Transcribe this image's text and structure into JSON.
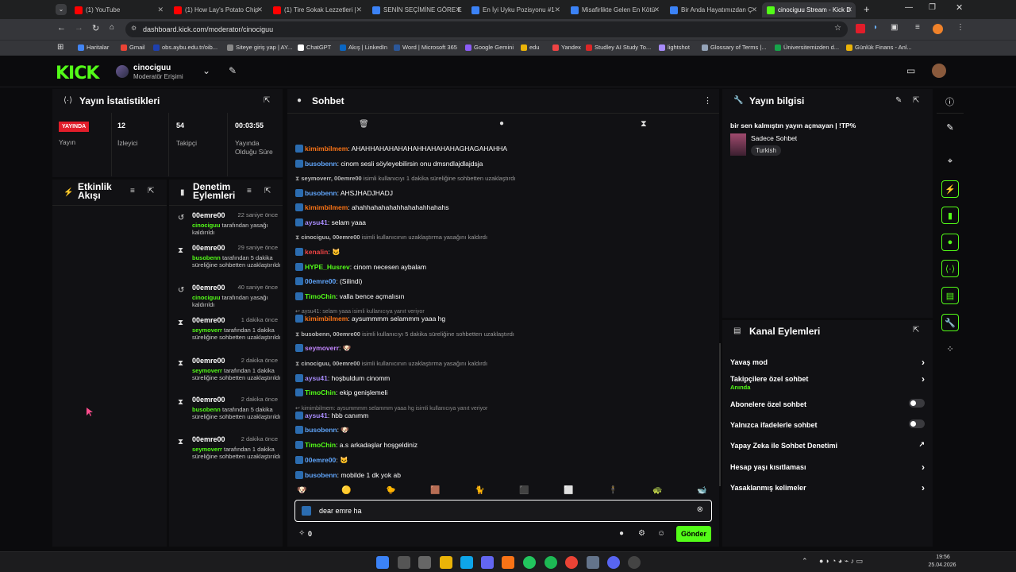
{
  "browser": {
    "tabs": [
      {
        "title": "(1) YouTube",
        "color": "#ff0000"
      },
      {
        "title": "(1) How Lay's Potato Chip",
        "color": "#ff0000"
      },
      {
        "title": "(1) Tire Sokak Lezzetleri |",
        "color": "#ff0000"
      },
      {
        "title": "SENİN SEÇİMİNE GÖRE E",
        "color": "#3b82f6"
      },
      {
        "title": "En İyi Uyku Pozisyonu #1",
        "color": "#3b82f6"
      },
      {
        "title": "Misafirlikte Gelen En Kötü",
        "color": "#3b82f6"
      },
      {
        "title": "Bir Anda Hayatımızdan Ç",
        "color": "#3b82f6"
      },
      {
        "title": "cinociguu Stream - Kick D",
        "color": "#53fc18"
      }
    ],
    "url": "dashboard.kick.com/moderator/cinociguu",
    "bookmarks": [
      "Haritalar",
      "Gmail",
      "obs.aybu.edu.tr/oib...",
      "Siteye giriş yap | AY...",
      "ChatGPT",
      "Akış | LinkedIn",
      "Word | Microsoft 365",
      "Google Gemini",
      "edu",
      "Yandex",
      "Studley AI Study To...",
      "lightshot",
      "Glossary of Terms |...",
      "Üniversitemizden d...",
      "Günlük Finans - Anl..."
    ]
  },
  "header": {
    "logo": "KICK",
    "channel": "cinociguu",
    "role": "Moderatör Erişimi"
  },
  "stats": {
    "title": "Yayın İstatistikleri",
    "live_badge": "YAYINDA",
    "items": [
      {
        "value": "",
        "label": "Yayın"
      },
      {
        "value": "12",
        "label": "İzleyici"
      },
      {
        "value": "54",
        "label": "Takipçi"
      },
      {
        "value": "00:03:55",
        "label": "Yayında Olduğu Süre"
      }
    ]
  },
  "activity": {
    "title": "Etkinlik Akışı"
  },
  "moderation": {
    "title": "Denetim Eylemleri",
    "items": [
      {
        "user": "00emre00",
        "time": "22 saniye önce",
        "by": "cinociguu",
        "text": "tarafından yasağı kaldırıldı",
        "icon": "↺"
      },
      {
        "user": "00emre00",
        "time": "29 saniye önce",
        "by": "busobenn",
        "text": "tarafından 5 dakika süreliğine sohbetten uzaklaştırıldı",
        "icon": "⧗"
      },
      {
        "user": "00emre00",
        "time": "40 saniye önce",
        "by": "cinociguu",
        "text": "tarafından yasağı kaldırıldı",
        "icon": "↺"
      },
      {
        "user": "00emre00",
        "time": "1 dakika önce",
        "by": "seymoverr",
        "text": "tarafından 1 dakika süreliğine sohbetten uzaklaştırıldı",
        "icon": "⧗"
      },
      {
        "user": "00emre00",
        "time": "2 dakika önce",
        "by": "seymoverr",
        "text": "tarafından 1 dakika süreliğine sohbetten uzaklaştırıldı",
        "icon": "⧗"
      },
      {
        "user": "00emre00",
        "time": "2 dakika önce",
        "by": "busobenn",
        "text": "tarafından 5 dakika süreliğine sohbetten uzaklaştırıldı",
        "icon": "⧗"
      },
      {
        "user": "00emre00",
        "time": "2 dakika önce",
        "by": "seymoverr",
        "text": "tarafından 1 dakika süreliğine sohbetten uzaklaştırıldı",
        "icon": "⧗"
      }
    ]
  },
  "chat": {
    "title": "Sohbet",
    "messages": [
      {
        "type": "msg",
        "user": "kimimbilmem",
        "color": "#f97316",
        "text": ": AHAHHAHAHAHAHAHHAHAHAHAGHAGAHAHHA"
      },
      {
        "type": "msg",
        "user": "busobenn",
        "color": "#60a5fa",
        "text": ": cinom sesli söyleyebilirsin onu dmsndlajdlajdsja"
      },
      {
        "type": "sys",
        "user": "seymoverr, 00emre00",
        "text": " isimli kullanıcıyı 1 dakika süreliğine sohbetten uzaklaştırdı"
      },
      {
        "type": "msg",
        "user": "busobenn",
        "color": "#60a5fa",
        "text": ": AHSJHADJHADJ"
      },
      {
        "type": "msg",
        "user": "kimimbilmem",
        "color": "#f97316",
        "text": ": ahahhahahahahhahahahhahahs"
      },
      {
        "type": "msg",
        "user": "aysu41",
        "color": "#a78bfa",
        "text": ": selam yaaa"
      },
      {
        "type": "sys",
        "user": "cinociguu, 00emre00",
        "text": " isimli kullanıcının uzaklaştırma yasağını kaldırdı"
      },
      {
        "type": "msg",
        "user": "kenalin",
        "color": "#ef4444",
        "text": ": 🐱"
      },
      {
        "type": "msg",
        "user": "HYPE_Husrev",
        "color": "#53fc18",
        "text": ": cinom necesen aybalam"
      },
      {
        "type": "msg",
        "user": "00emre00",
        "color": "#60a5fa",
        "text": ": (Silindi)"
      },
      {
        "type": "msg",
        "user": "TimoChin",
        "color": "#53fc18",
        "text": ": valla bence açmalısın"
      },
      {
        "type": "reply",
        "text": "aysu41: selam yaaa isimli kullanıcıya yanıt veriyor"
      },
      {
        "type": "msg",
        "user": "kimimbilmem",
        "color": "#f97316",
        "text": ": aysummmm selammm yaaa hg"
      },
      {
        "type": "sys",
        "user": "busobenn, 00emre00",
        "text": " isimli kullanıcıyı 5 dakika süreliğine sohbetten uzaklaştırdı"
      },
      {
        "type": "msg",
        "user": "seymoverr",
        "color": "#c084fc",
        "text": ": 🐶"
      },
      {
        "type": "sys",
        "user": "cinociguu, 00emre00",
        "text": " isimli kullanıcının uzaklaştırma yasağını kaldırdı"
      },
      {
        "type": "msg",
        "user": "aysu41",
        "color": "#a78bfa",
        "text": ": hoşbuldum cinomm"
      },
      {
        "type": "msg",
        "user": "TimoChin",
        "color": "#53fc18",
        "text": ": ekip genişlemeli"
      },
      {
        "type": "reply",
        "text": "kimimbilmem: aysummmm selammm yaaa hg isimli kullanıcıya yanıt veriyor"
      },
      {
        "type": "msg",
        "user": "aysu41",
        "color": "#a78bfa",
        "text": ": hbb canımm"
      },
      {
        "type": "msg",
        "user": "busobenn",
        "color": "#60a5fa",
        "text": ": 🐶"
      },
      {
        "type": "msg",
        "user": "TimoChin",
        "color": "#53fc18",
        "text": ": a.s arkadaşlar hoşgeldiniz"
      },
      {
        "type": "msg",
        "user": "00emre00",
        "color": "#60a5fa",
        "text": ": 🐱"
      },
      {
        "type": "msg",
        "user": "busobenn",
        "color": "#60a5fa",
        "text": ": mobilde 1 dk yok ab"
      }
    ],
    "input_value": "dear emre ha",
    "send_label": "Gönder",
    "points": "0"
  },
  "stream_info": {
    "title": "Yayın bilgisi",
    "stream_title": "bir sen kalmıştın yayın açmayan | !TP%",
    "category": "Sadece Sohbet",
    "tag": "Turkish"
  },
  "channel_actions": {
    "title": "Kanal Eylemleri",
    "items": [
      {
        "label": "Yavaş mod",
        "sub": "",
        "control": "arrow"
      },
      {
        "label": "Takipçilere özel sohbet",
        "sub": "Anında",
        "control": "arrow"
      },
      {
        "label": "Abonelere özel sohbet",
        "sub": "",
        "control": "toggle"
      },
      {
        "label": "Yalnızca ifadelerle sohbet",
        "sub": "",
        "control": "toggle"
      },
      {
        "label": "Yapay Zeka ile Sohbet Denetimi",
        "sub": "",
        "control": "link"
      },
      {
        "label": "Hesap yaşı kısıtlaması",
        "sub": "",
        "control": "arrow"
      },
      {
        "label": "Yasaklanmış kelimeler",
        "sub": "",
        "control": "arrow"
      }
    ]
  },
  "taskbar": {
    "time": "19:56",
    "date": "25.04.2026"
  }
}
